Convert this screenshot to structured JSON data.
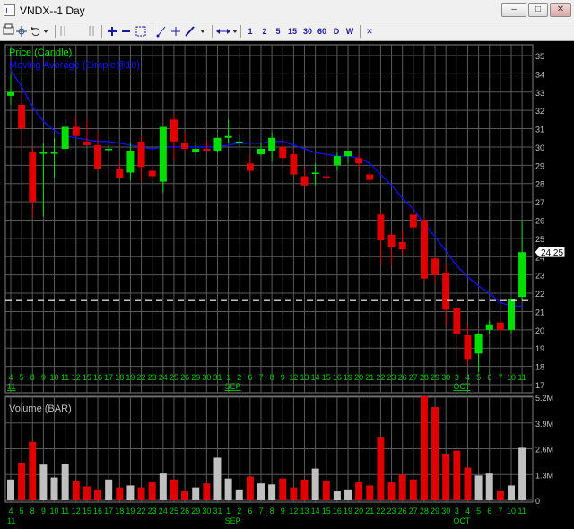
{
  "window": {
    "title": "VNDX--1 Day",
    "minimize": "–",
    "maximize": "□",
    "close": "✕"
  },
  "toolbar": {
    "tools": [
      "print-icon",
      "crosshair-icon",
      "undo-icon",
      "dropdown-icon",
      "pause-icon",
      "zoom-in-icon",
      "zoom-out-icon",
      "fit-icon",
      "draw-line-icon",
      "cross-icon",
      "pen-icon",
      "dropdown-icon",
      "scroll-icon",
      "dropdown-icon"
    ],
    "intervals": [
      "1",
      "2",
      "5",
      "15",
      "30",
      "60",
      "D",
      "W"
    ],
    "close_chart": "✕"
  },
  "chart_data": [
    {
      "type": "candlestick",
      "legend": [
        "Price (Candle)",
        "Moving Average (Simple@10)"
      ],
      "colors": {
        "up": "#00e000",
        "down": "#e00000",
        "ma": "#1010ff",
        "grid": "#5a5a5a",
        "axis": "#c0c0c0",
        "date": "#00c800"
      },
      "ylim": [
        17,
        35
      ],
      "yticks": [
        17,
        18,
        19,
        20,
        21,
        22,
        23,
        24,
        25,
        26,
        27,
        28,
        29,
        30,
        31,
        32,
        33,
        34,
        35
      ],
      "last_price": "24.25",
      "reference_line": 21.6,
      "dates": [
        "4",
        "5",
        "8",
        "9",
        "10",
        "11",
        "12",
        "15",
        "16",
        "17",
        "18",
        "19",
        "22",
        "23",
        "24",
        "25",
        "26",
        "29",
        "30",
        "31",
        "1",
        "2",
        "6",
        "7",
        "8",
        "9",
        "12",
        "13",
        "14",
        "15",
        "16",
        "19",
        "20",
        "21",
        "22",
        "23",
        "26",
        "27",
        "28",
        "29",
        "30",
        "3",
        "4",
        "5",
        "6",
        "7",
        "10",
        "11"
      ],
      "month_labels": [
        {
          "index": 0,
          "text": "11"
        },
        {
          "index": 20,
          "text": "SEP"
        },
        {
          "index": 41,
          "text": "OCT"
        }
      ],
      "open": [
        32.8,
        32.3,
        29.7,
        29.7,
        29.7,
        29.9,
        31.1,
        30.3,
        30.1,
        29.9,
        28.8,
        28.6,
        30.3,
        28.7,
        28.1,
        31.5,
        30.2,
        29.7,
        29.9,
        29.8,
        30.5,
        30.2,
        29.1,
        29.6,
        29.8,
        30.0,
        29.6,
        28.4,
        28.6,
        28.4,
        29.0,
        29.5,
        29.4,
        28.5,
        26.3,
        25.2,
        24.8,
        26.3,
        26.0,
        23.9,
        23.1,
        21.2,
        19.7,
        18.7,
        20.0,
        20.4,
        20.0,
        21.8
      ],
      "high": [
        34.0,
        33.0,
        30.0,
        30.2,
        30.5,
        31.5,
        31.7,
        31.5,
        30.8,
        30.1,
        29.2,
        30.2,
        30.6,
        29.0,
        31.0,
        31.8,
        30.8,
        30.3,
        30.3,
        30.4,
        31.5,
        30.7,
        29.5,
        30.2,
        30.8,
        30.5,
        29.9,
        28.9,
        29.1,
        29.1,
        29.7,
        29.7,
        29.6,
        28.6,
        26.4,
        25.3,
        25.5,
        26.7,
        26.2,
        24.0,
        23.6,
        21.5,
        20.3,
        19.3,
        20.5,
        20.6,
        20.6,
        26.0
      ],
      "low": [
        32.3,
        29.8,
        26.1,
        26.2,
        28.3,
        29.6,
        30.7,
        30.1,
        29.0,
        29.7,
        28.5,
        28.2,
        28.1,
        28.0,
        27.5,
        29.3,
        29.8,
        29.5,
        29.8,
        29.7,
        30.2,
        30.0,
        28.6,
        29.5,
        29.2,
        29.0,
        28.5,
        28.3,
        27.9,
        28.1,
        28.7,
        29.1,
        28.8,
        27.7,
        23.5,
        23.5,
        24.1,
        25.4,
        22.7,
        22.6,
        20.2,
        18.3,
        18.1,
        17.7,
        19.8,
        19.6,
        19.8,
        21.6
      ],
      "close": [
        33.0,
        31.0,
        27.0,
        29.7,
        29.7,
        31.1,
        30.6,
        30.1,
        28.8,
        29.9,
        28.3,
        29.8,
        28.9,
        28.4,
        31.1,
        30.3,
        29.9,
        29.9,
        29.8,
        30.5,
        30.6,
        30.3,
        28.7,
        29.9,
        30.5,
        29.4,
        28.5,
        27.9,
        28.6,
        28.3,
        29.5,
        29.8,
        29.1,
        28.2,
        24.9,
        24.5,
        24.4,
        25.6,
        22.8,
        23.0,
        21.1,
        19.8,
        18.4,
        19.8,
        20.3,
        20.0,
        21.7,
        24.25
      ],
      "ma": [
        34.2,
        33.3,
        32.2,
        31.4,
        30.9,
        30.6,
        30.5,
        30.4,
        30.3,
        30.3,
        30.2,
        30.1,
        30.0,
        29.9,
        30.0,
        30.0,
        30.0,
        30.0,
        30.0,
        30.0,
        30.1,
        30.2,
        30.2,
        30.2,
        30.3,
        30.3,
        30.1,
        29.9,
        29.7,
        29.6,
        29.5,
        29.5,
        29.4,
        29.1,
        28.5,
        27.9,
        27.2,
        26.6,
        25.8,
        25.1,
        24.3,
        23.5,
        22.9,
        22.4,
        22.0,
        21.5,
        21.3,
        21.3
      ]
    },
    {
      "type": "bar",
      "legend": [
        "Volume (BAR)"
      ],
      "colors": {
        "up": "#c0c0c0",
        "down": "#e00000"
      },
      "ylim": [
        0,
        5200000
      ],
      "yticks": [
        0,
        1300000,
        2600000,
        3900000,
        5200000
      ],
      "ytick_labels": [
        "0",
        "1.3M",
        "2.6M",
        "3.9M",
        "5.2M"
      ],
      "values": [
        1.05,
        1.9,
        2.95,
        1.8,
        1.15,
        1.85,
        0.95,
        0.7,
        0.55,
        1.05,
        0.65,
        0.75,
        0.65,
        0.9,
        1.35,
        1.05,
        0.45,
        0.65,
        0.85,
        2.15,
        1.1,
        0.55,
        1.2,
        0.85,
        0.8,
        1.1,
        0.65,
        1.05,
        1.6,
        1.0,
        0.45,
        0.55,
        0.9,
        0.75,
        3.2,
        0.9,
        1.3,
        1.05,
        5.25,
        4.7,
        2.35,
        2.5,
        1.65,
        1.25,
        1.35,
        0.45,
        0.75,
        2.65
      ]
    }
  ]
}
